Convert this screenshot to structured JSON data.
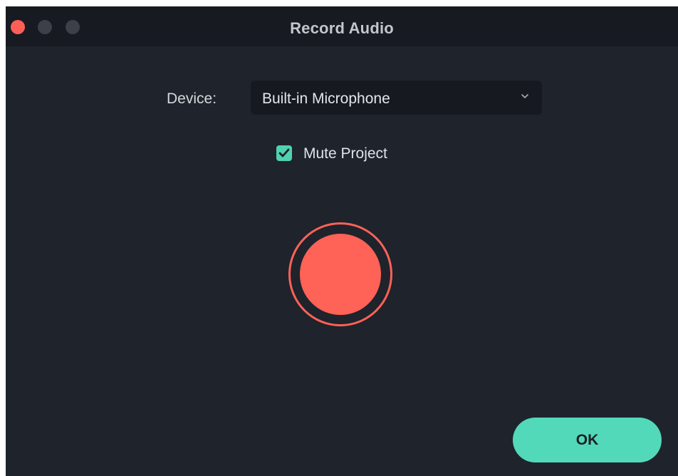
{
  "window": {
    "title": "Record Audio",
    "controls": [
      "close",
      "minimize",
      "zoom"
    ]
  },
  "device": {
    "label": "Device:",
    "selected": "Built-in Microphone"
  },
  "mute_project": {
    "label": "Mute Project",
    "checked": true
  },
  "record": {
    "state": "idle"
  },
  "ok_label": "OK",
  "colors": {
    "window_bg": "#1f232b",
    "titlebar_bg": "#171a20",
    "close": "#fd5f57",
    "inactive_control": "#3c4049",
    "record": "#ff6257",
    "accent": "#52d9ba"
  },
  "icons": {
    "close": "traffic-light-close",
    "minimize": "traffic-light-minimize",
    "zoom": "traffic-light-zoom",
    "dropdown": "chevron-down-icon",
    "checkbox": "checkmark-icon",
    "record": "record-circle-icon"
  }
}
